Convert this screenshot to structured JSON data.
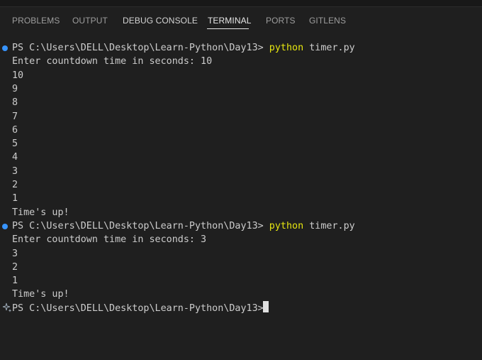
{
  "panel": {
    "tabs": [
      {
        "label": "PROBLEMS"
      },
      {
        "label": "OUTPUT"
      },
      {
        "label": "DEBUG CONSOLE"
      },
      {
        "label": "TERMINAL"
      },
      {
        "label": "PORTS"
      },
      {
        "label": "GITLENS"
      }
    ],
    "active_tab": "TERMINAL"
  },
  "terminal": {
    "lines": [
      {
        "prompt": "PS C:\\Users\\DELL\\Desktop\\Learn-Python\\Day13> ",
        "command": "python",
        "args": " timer.py"
      },
      {
        "text": "Enter countdown time in seconds: 10"
      },
      {
        "text": "10"
      },
      {
        "text": "9"
      },
      {
        "text": "8"
      },
      {
        "text": "7"
      },
      {
        "text": "6"
      },
      {
        "text": "5"
      },
      {
        "text": "4"
      },
      {
        "text": "3"
      },
      {
        "text": "2"
      },
      {
        "text": "1"
      },
      {
        "text": "Time's up!"
      },
      {
        "prompt": "PS C:\\Users\\DELL\\Desktop\\Learn-Python\\Day13> ",
        "command": "python",
        "args": " timer.py"
      },
      {
        "text": "Enter countdown time in seconds: 3"
      },
      {
        "text": "3"
      },
      {
        "text": "2"
      },
      {
        "text": "1"
      },
      {
        "text": "Time's up!"
      },
      {
        "prompt": "PS C:\\Users\\DELL\\Desktop\\Learn-Python\\Day13> "
      }
    ]
  },
  "colors": {
    "background": "#1f1f1f",
    "command": "#e5e510",
    "decoration_dot": "#3794ff",
    "text": "#cccccc"
  }
}
